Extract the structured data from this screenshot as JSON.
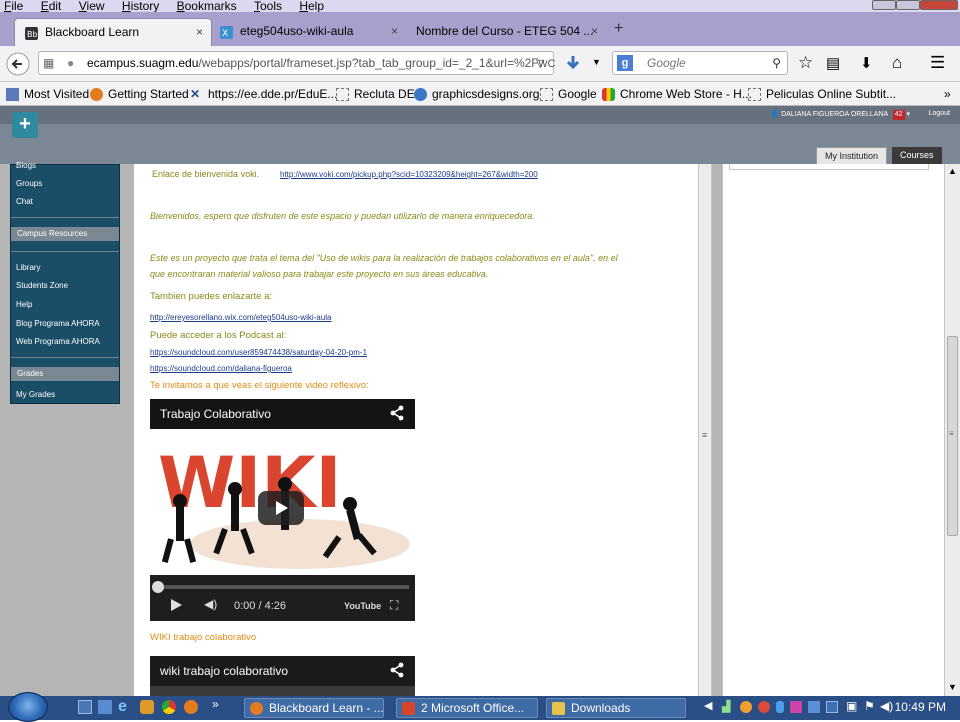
{
  "menubar": {
    "items": [
      "File",
      "Edit",
      "View",
      "History",
      "Bookmarks",
      "Tools",
      "Help"
    ]
  },
  "tabs": [
    {
      "label": "Blackboard Learn",
      "close": "×",
      "icon": "blackboard-favicon"
    },
    {
      "label": "eteg504uso-wiki-aula",
      "close": "×",
      "icon": "wix-favicon"
    },
    {
      "label": "Nombre del Curso - ETEG 504 ...",
      "close": "×",
      "icon": "none"
    }
  ],
  "new_tab_label": "+",
  "navbar": {
    "url_domain": "ecampus.suagm.edu",
    "url_path": "/webapps/portal/frameset.jsp?tab_tab_group_id=_2_1&url=%2Fw",
    "url_prefix": "",
    "search_placeholder": "Google"
  },
  "bookmarks": [
    {
      "label": "Most Visited",
      "icon": "bookmark-icon"
    },
    {
      "label": "Getting Started",
      "icon": "firefox-icon"
    },
    {
      "label": "https://ee.dde.pr/EduE...",
      "icon": "edu-icon"
    },
    {
      "label": "Recluta DE",
      "icon": "page-icon"
    },
    {
      "label": "graphicsdesigns.org",
      "icon": "globe-icon"
    },
    {
      "label": "Google",
      "icon": "page-icon"
    },
    {
      "label": "Chrome Web Store - H...",
      "icon": "chrome-store-icon"
    },
    {
      "label": "Peliculas Online Subtit...",
      "icon": "page-icon"
    }
  ],
  "bookmarks_overflow": "»",
  "bb_header": {
    "user_name": "DALIANA FIGUEROA ORELLANA",
    "notification_count": "42",
    "logout": "Logout",
    "tabs": [
      "My Institution",
      "Courses"
    ]
  },
  "sidebar": {
    "items_top": [
      "Blogs",
      "Groups",
      "Chat"
    ],
    "campus_header": "Campus Resources",
    "campus_items": [
      "Library",
      "Students Zone",
      "Help",
      "Blog Programa AHORA",
      "Web Programa AHORA"
    ],
    "grades_header": "Grades",
    "grades_items": [
      "My Grades"
    ]
  },
  "content": {
    "voki_label": "Enlace de bienvenida voki.",
    "voki_link": "http://www.voki.com/pickup.php?scid=10323209&height=267&width=200",
    "welcome": "Bienvenidos, espero que disfruten de este espacio y puedan utilizarlo de manera enriquecedora.",
    "project_line1": "Este es un proyecto que trata el tema del \"Uso de wikis para la realización de trabajos colaborativos en el aula\", en el",
    "project_line2": "que encontraran material valioso para trabajar este proyecto en sus áreas educativa.",
    "also_link_label": "Tambien puedes enlazarte a:",
    "wix_link": "http://ereyesorellano.wix.com/eteg504uso-wiki-aula",
    "podcast_label": "Puede acceder a los Podcast al:",
    "podcast_link1": "https://soundcloud.com/user859474438/saturday-04-20-pm-1",
    "podcast_link2": "https://soundcloud.com/daliana-figueroa",
    "video_invite": "Te invitamos a que veas el siguiente video reflexivo:",
    "video1_title": "Trabajo Colaborativo",
    "video1_art_text": "WIKI",
    "video1_time": "0:00 / 4:26",
    "video1_brand": "YouTube",
    "video2_caption": "WIKI trabajo colaborativo",
    "video2_title": "wiki trabajo colaborativo"
  },
  "taskbar": {
    "items": [
      {
        "label": "Blackboard Learn - ...",
        "icon": "firefox-icon"
      },
      {
        "label": "2 Microsoft Office...",
        "icon": "office-icon"
      },
      {
        "label": "Downloads",
        "icon": "folder-icon"
      }
    ],
    "clock": "10:49 PM"
  }
}
